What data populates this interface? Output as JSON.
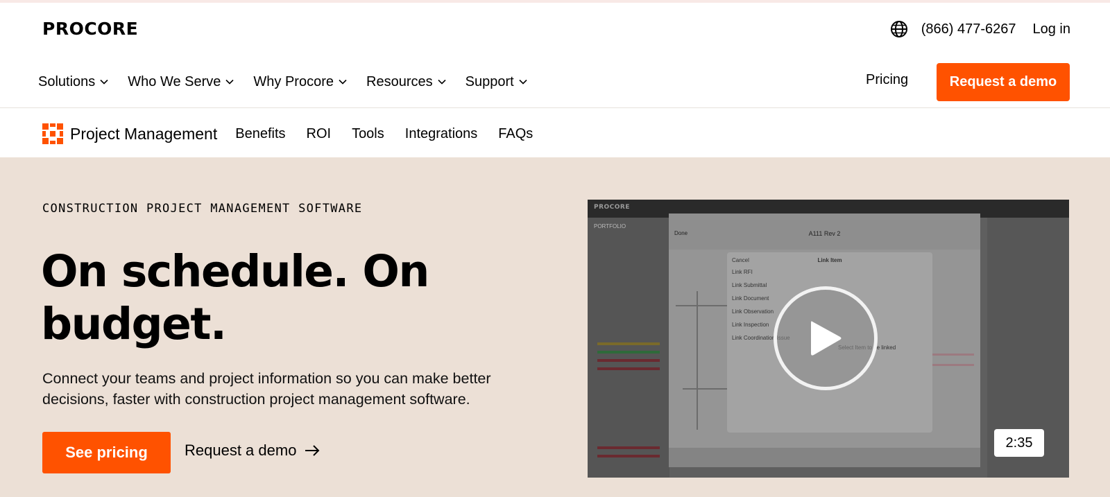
{
  "brand": {
    "logo_text": "PROCORE",
    "accent": "#ff5200"
  },
  "utility": {
    "language_icon": "globe-icon",
    "phone": "(866) 477-6267",
    "login": "Log in"
  },
  "nav": {
    "items": [
      {
        "label": "Solutions"
      },
      {
        "label": "Who We Serve"
      },
      {
        "label": "Why Procore"
      },
      {
        "label": "Resources"
      },
      {
        "label": "Support"
      }
    ],
    "pricing": "Pricing",
    "demo": "Request a demo"
  },
  "subnav": {
    "title": "Project Management",
    "links": [
      "Benefits",
      "ROI",
      "Tools",
      "Integrations",
      "FAQs"
    ]
  },
  "hero": {
    "eyebrow": "CONSTRUCTION PROJECT MANAGEMENT SOFTWARE",
    "headline": "On schedule. On budget.",
    "description": "Connect your teams and project information so you can make better decisions, faster with construction project management software.",
    "primary_cta": "See pricing",
    "secondary_cta": "Request a demo",
    "background": "#ece0d6"
  },
  "video": {
    "duration": "2:35",
    "play_icon": "play-icon",
    "screen_title": "A111 Rev 2",
    "screen_done": "Done",
    "modal_title": "Link Item",
    "modal_cancel": "Cancel",
    "modal_items": [
      "Link RFI",
      "Link Submittal",
      "Link Document",
      "Link Observation",
      "Link Inspection",
      "Link Coordination Issue"
    ],
    "side_label": "PORTFOLIO",
    "hint": "Select Item to be linked"
  }
}
